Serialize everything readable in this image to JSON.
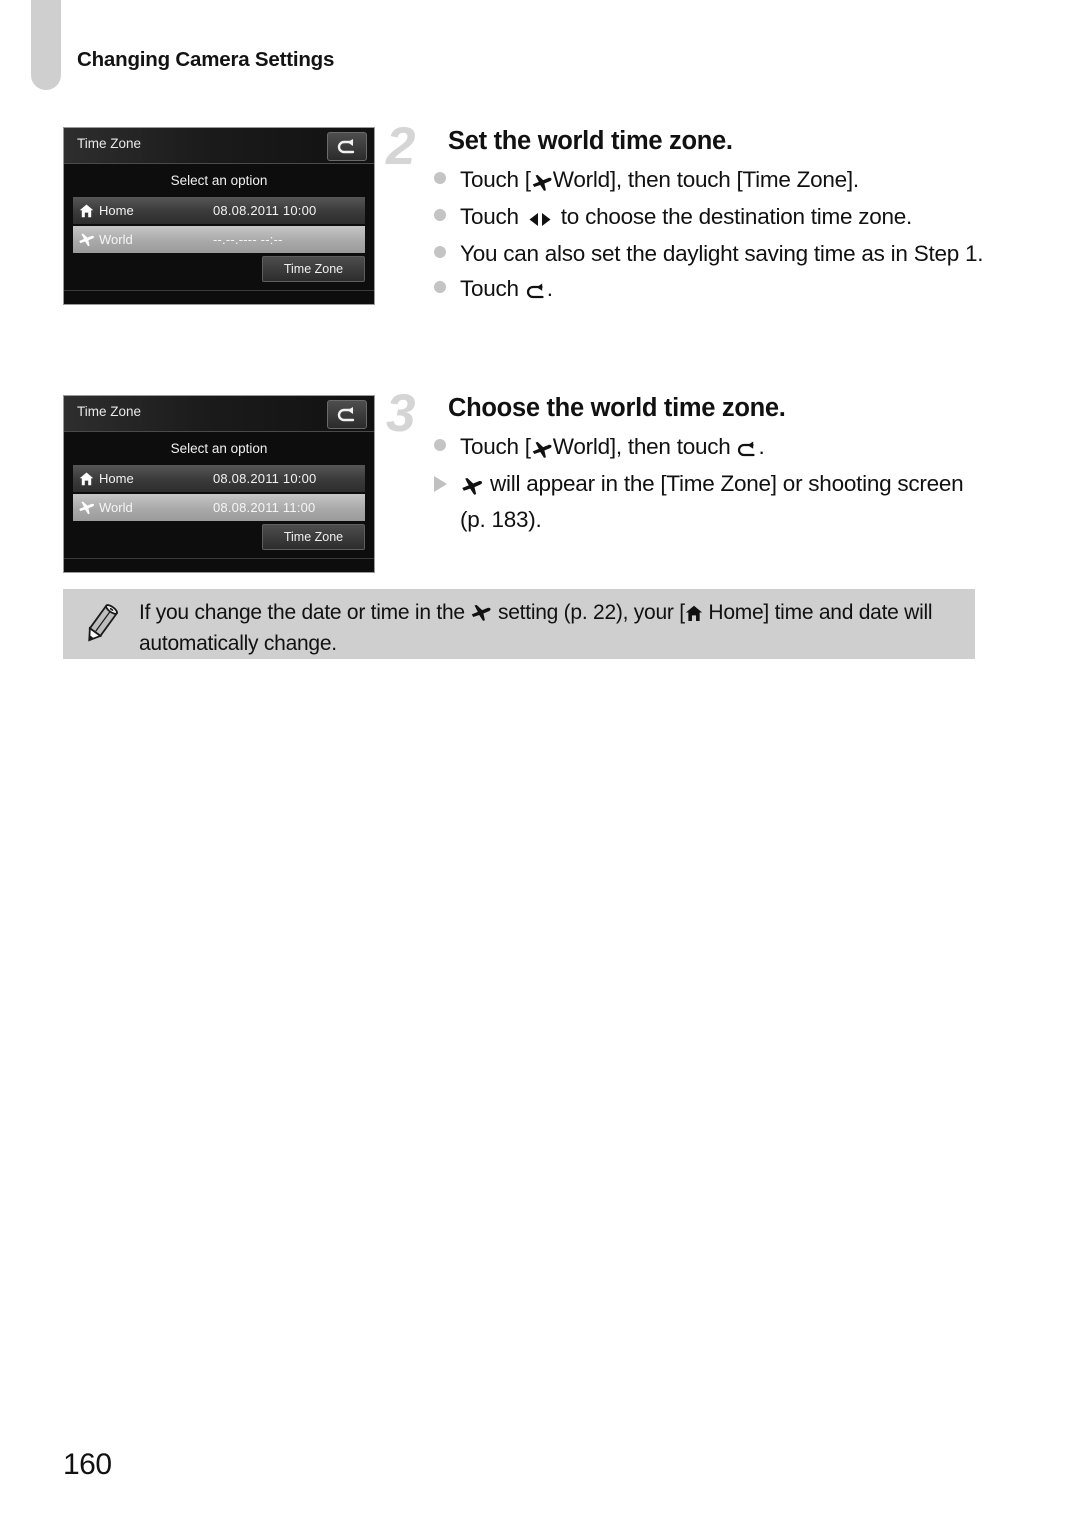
{
  "header": {
    "section_title": "Changing Camera Settings",
    "tab_marker": "chapter-tab"
  },
  "screens": [
    {
      "id": "screen-1",
      "topbar_title": "Time Zone",
      "back_icon": "return-arrow-icon",
      "subtitle": "Select an option",
      "rows": [
        {
          "icon": "home-icon",
          "label": "Home",
          "value": "08.08.2011 10:00",
          "state": "normal"
        },
        {
          "icon": "airplane-icon",
          "label": "World",
          "value": "--.--.---- --:--",
          "state": "selected"
        }
      ],
      "button_label": "Time Zone"
    },
    {
      "id": "screen-2",
      "topbar_title": "Time Zone",
      "back_icon": "return-arrow-icon",
      "subtitle": "Select an option",
      "rows": [
        {
          "icon": "home-icon",
          "label": "Home",
          "value": "08.08.2011 10:00",
          "state": "normal"
        },
        {
          "icon": "airplane-icon",
          "label": "World",
          "value": "08.08.2011 11:00",
          "state": "selected"
        }
      ],
      "button_label": "Time Zone"
    }
  ],
  "steps": [
    {
      "number": "2",
      "heading": "Set the world time zone.",
      "bullets": [
        {
          "marker": "dot",
          "parts": [
            {
              "type": "text",
              "value": "Touch ["
            },
            {
              "type": "icon",
              "value": "airplane-icon"
            },
            {
              "type": "text",
              "value": "World], then touch [Time Zone]."
            }
          ]
        },
        {
          "marker": "dot",
          "parts": [
            {
              "type": "text",
              "value": "Touch "
            },
            {
              "type": "icon",
              "value": "left-right-arrows-icon"
            },
            {
              "type": "text",
              "value": " to choose the destination time zone."
            }
          ]
        },
        {
          "marker": "dot",
          "parts": [
            {
              "type": "text",
              "value": "You can also set the daylight saving time as in Step 1."
            }
          ]
        },
        {
          "marker": "dot",
          "parts": [
            {
              "type": "text",
              "value": "Touch "
            },
            {
              "type": "icon",
              "value": "return-arrow-icon"
            },
            {
              "type": "text",
              "value": "."
            }
          ]
        }
      ]
    },
    {
      "number": "3",
      "heading": "Choose the world time zone.",
      "bullets": [
        {
          "marker": "dot",
          "parts": [
            {
              "type": "text",
              "value": "Touch ["
            },
            {
              "type": "icon",
              "value": "airplane-icon"
            },
            {
              "type": "text",
              "value": "World], then touch "
            },
            {
              "type": "icon",
              "value": "return-arrow-icon"
            },
            {
              "type": "text",
              "value": "."
            }
          ]
        },
        {
          "marker": "triangle",
          "parts": [
            {
              "type": "icon",
              "value": "airplane-icon"
            },
            {
              "type": "text",
              "value": " will appear in the [Time Zone] or shooting screen (p. 183)."
            }
          ]
        }
      ]
    }
  ],
  "note": {
    "icon": "pencil-icon",
    "parts": [
      {
        "type": "text",
        "value": "If you change the date or time in the "
      },
      {
        "type": "icon",
        "value": "airplane-icon"
      },
      {
        "type": "text",
        "value": " setting (p. 22), your ["
      },
      {
        "type": "icon",
        "value": "home-icon"
      },
      {
        "type": "text",
        "value": " Home] time and date will automatically change."
      }
    ]
  },
  "footer": {
    "page_number": "160"
  },
  "colors": {
    "tab_gray": "#cfcfcf",
    "note_bg": "#cfcfcf",
    "step_number": "#d5d5d5",
    "bullet_dot": "#c4c4c4",
    "screen_bg": "#0d0d0d",
    "row_selected": "#a9a9a9"
  }
}
